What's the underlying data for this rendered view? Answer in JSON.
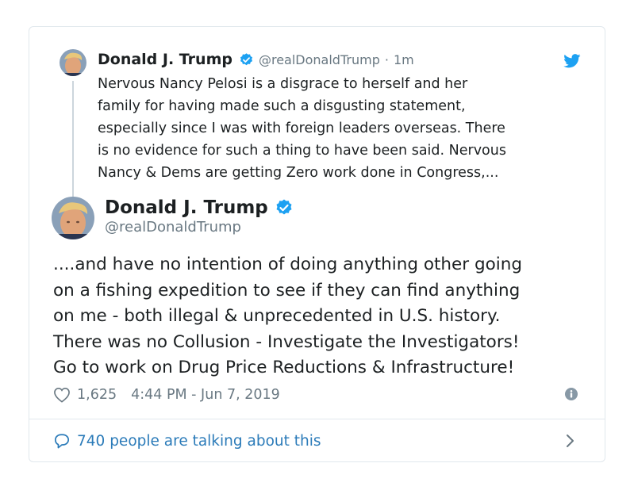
{
  "parent_tweet": {
    "author_name": "Donald J. Trump",
    "handle": "@realDonaldTrump",
    "separator": "·",
    "time_ago": "1m",
    "text": "Nervous Nancy Pelosi is a disgrace to herself and her\nfamily for having made such a disgusting statement,\nespecially since I was with foreign leaders overseas. There\nis no evidence for such a thing to have been said. Nervous\nNancy & Dems are getting Zero work done in Congress,..."
  },
  "main_tweet": {
    "author_name": "Donald J. Trump",
    "handle": "@realDonaldTrump",
    "text": "....and have no intention of doing anything other going\non a fishing expedition to see if they can find anything\non me - both illegal & unprecedented in U.S. history.\nThere was no Collusion - Investigate the Investigators!\nGo to work on Drug Price Reductions & Infrastructure!",
    "like_count": "1,625",
    "timestamp": "4:44 PM - Jun 7, 2019"
  },
  "footer": {
    "talking_label": "740 people are talking about this"
  },
  "icons": {
    "verified": "verified-badge-icon",
    "bird": "twitter-bird-icon",
    "heart": "heart-icon",
    "info": "info-icon",
    "bubble": "speech-bubble-icon",
    "chevron": "chevron-right-icon"
  },
  "colors": {
    "brand_blue": "#1da1f2",
    "link_blue": "#2b7bb9",
    "muted_text": "#697882",
    "body_text": "#1c2022",
    "border": "#e1e8ed"
  }
}
